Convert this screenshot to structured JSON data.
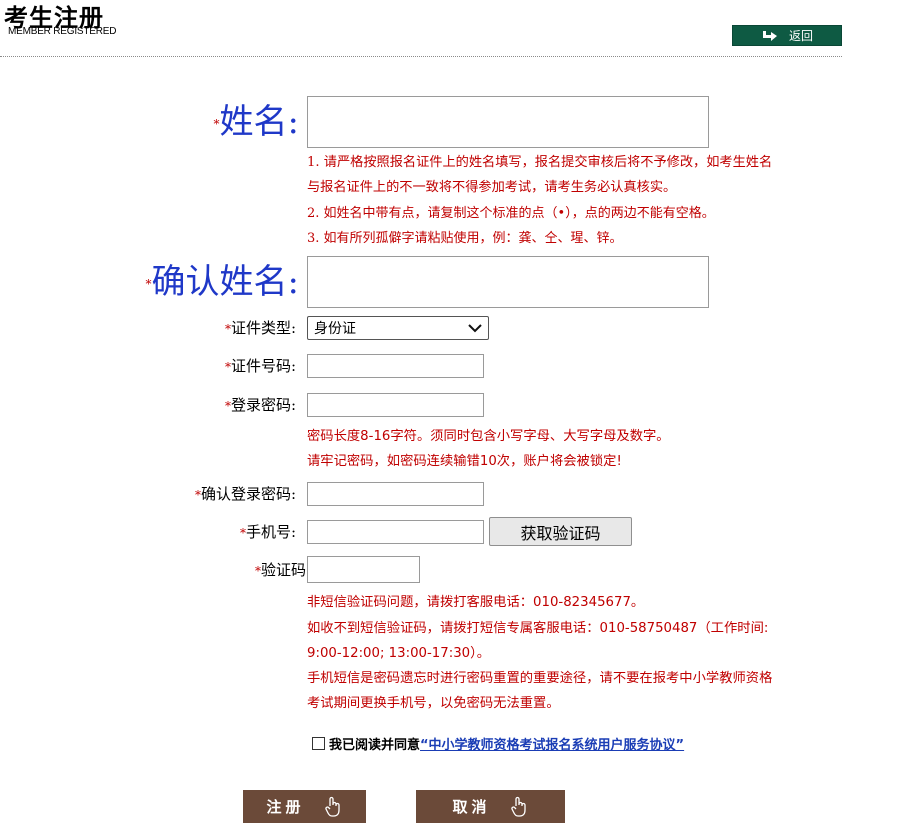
{
  "header": {
    "title": "考生注册",
    "subtitle": "MEMBER REGISTERED",
    "back_label": "返回"
  },
  "form": {
    "required_mark": "*",
    "name_label": "姓名:",
    "name_notes": [
      "1. 请严格按照报名证件上的姓名填写，报名提交审核后将不予修改，如考生姓名",
      "与报名证件上的不一致将不得参加考试，请考生务必认真核实。",
      "2. 如姓名中带有点，请复制这个标准的点（•），点的两边不能有空格。",
      "3. 如有所列孤僻字请粘贴使用，例：龚、仝、瑆、锌。"
    ],
    "confirm_name_label": "确认姓名:",
    "id_type_label": "证件类型:",
    "id_type_value": "身份证",
    "id_number_label": "证件号码:",
    "password_label": "登录密码:",
    "password_notes": [
      "密码长度8-16字符。须同时包含小写字母、大写字母及数字。",
      "请牢记密码，如密码连续输错10次，账户将会被锁定!"
    ],
    "confirm_password_label": "确认登录密码:",
    "phone_label": "手机号:",
    "get_code_label": "获取验证码",
    "code_label": "验证码",
    "code_notes": [
      "非短信验证码问题，请拨打客服电话：010-82345677。",
      "如收不到短信验证码，请拨打短信专属客服电话：010-58750487（工作时间:",
      "9:00-12:00; 13:00-17:30）。",
      "手机短信是密码遗忘时进行密码重置的重要途径，请不要在报考中小学教师资格",
      "考试期间更换手机号，以免密码无法重置。"
    ],
    "agree_text": "我已阅读并同意",
    "agree_link": "“中小学教师资格考试报名系统用户服务协议”"
  },
  "actions": {
    "register_label": "注册",
    "cancel_label": "取消"
  },
  "colors": {
    "accent_green": "#0e5a43",
    "note_red": "#c00000",
    "label_blue": "#1f38c8",
    "button_brown": "#6b4a39"
  }
}
